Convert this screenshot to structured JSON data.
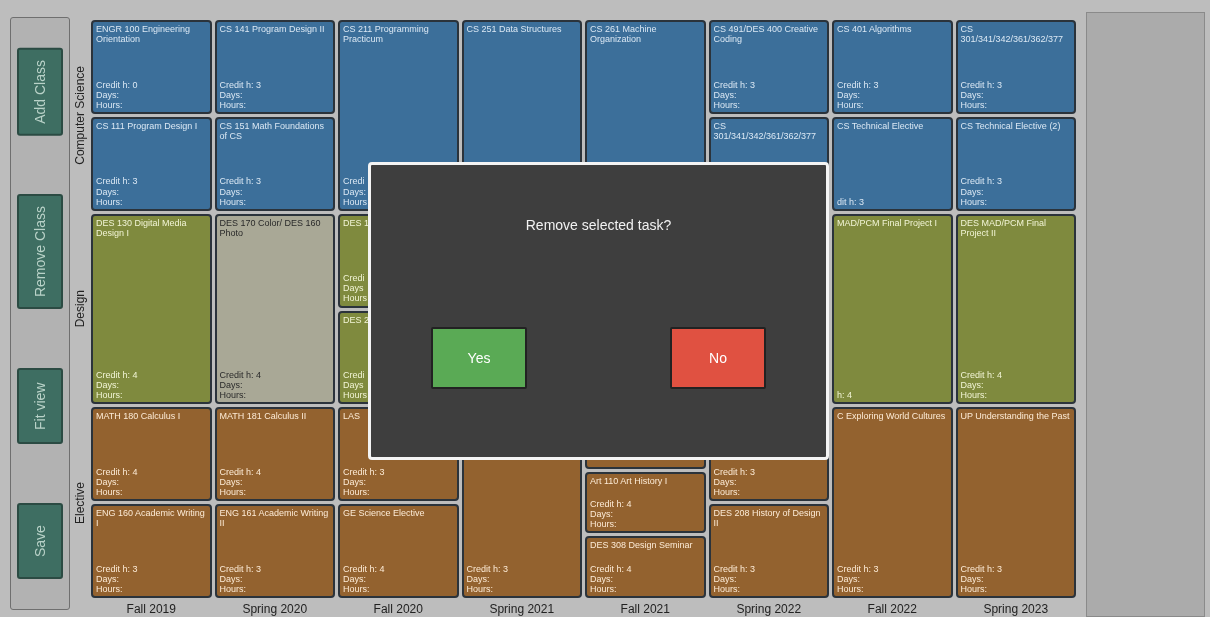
{
  "sidebar": {
    "buttons": [
      "Add Class",
      "Remove Class",
      "Fit view",
      "Save"
    ]
  },
  "rows": [
    {
      "label": "Computer Science",
      "kind": "cs"
    },
    {
      "label": "Design",
      "kind": "design"
    },
    {
      "label": "Elective",
      "kind": "elective"
    }
  ],
  "columns": [
    {
      "term": "Fall 2019",
      "sections": [
        {
          "kind": "cs",
          "cards": [
            {
              "title": "ENGR 100 Engineering Orientation",
              "credit": "Credit h: 0",
              "days": "Days:",
              "hours": "Hours:",
              "selected": false
            },
            {
              "title": "CS 111 Program Design I",
              "credit": "Credit h: 3",
              "days": "Days:",
              "hours": "Hours:",
              "selected": false
            }
          ]
        },
        {
          "kind": "design",
          "cards": [
            {
              "title": "DES 130 Digital Media Design I",
              "credit": "Credit h: 4",
              "days": "Days:",
              "hours": "Hours:",
              "selected": false
            }
          ]
        },
        {
          "kind": "elective",
          "cards": [
            {
              "title": "MATH 180 Calculus I",
              "credit": "Credit h: 4",
              "days": "Days:",
              "hours": "Hours:",
              "selected": false
            },
            {
              "title": "ENG 160 Academic Writing I",
              "credit": "Credit h: 3",
              "days": "Days:",
              "hours": "Hours:",
              "selected": false
            }
          ]
        }
      ]
    },
    {
      "term": "Spring 2020",
      "sections": [
        {
          "kind": "cs",
          "cards": [
            {
              "title": "CS 141 Program Design II",
              "credit": "Credit h: 3",
              "days": "Days:",
              "hours": "Hours:",
              "selected": false
            },
            {
              "title": "CS 151 Math Foundations of CS",
              "credit": "Credit h: 3",
              "days": "Days:",
              "hours": "Hours:",
              "selected": false
            }
          ]
        },
        {
          "kind": "design",
          "cards": [
            {
              "title": "DES 170 Color/ DES 160 Photo",
              "credit": "Credit h: 4",
              "days": "Days:",
              "hours": "Hours:",
              "selected": true
            }
          ]
        },
        {
          "kind": "elective",
          "cards": [
            {
              "title": "MATH 181 Calculus II",
              "credit": "Credit h: 4",
              "days": "Days:",
              "hours": "Hours:",
              "selected": false
            },
            {
              "title": "ENG 161 Academic Writing II",
              "credit": "Credit h: 3",
              "days": "Days:",
              "hours": "Hours:",
              "selected": false
            }
          ]
        }
      ]
    },
    {
      "term": "Fall 2020",
      "sections": [
        {
          "kind": "cs",
          "cards": [
            {
              "title": "CS 211 Programming Practicum",
              "credit": "Credi",
              "days": "Days:",
              "hours": "Hours",
              "selected": false
            }
          ]
        },
        {
          "kind": "design",
          "cards": [
            {
              "title": "DES 1",
              "credit": "Credi",
              "days": "Days",
              "hours": "Hours",
              "selected": false
            },
            {
              "title": "DES 2",
              "credit": "Credi",
              "days": "Days",
              "hours": "Hours",
              "selected": false
            }
          ]
        },
        {
          "kind": "elective",
          "cards": [
            {
              "title": "LAS",
              "credit": "Credit h: 3",
              "days": "Days:",
              "hours": "Hours:",
              "selected": false
            },
            {
              "title": "GE Science Elective",
              "credit": "Credit h: 4",
              "days": "Days:",
              "hours": "Hours:",
              "selected": false
            }
          ]
        }
      ]
    },
    {
      "term": "Spring 2021",
      "sections": [
        {
          "kind": "cs",
          "cards": [
            {
              "title": "CS 251 Data Structures",
              "selected": false
            }
          ]
        },
        {
          "kind": "elective",
          "cards": [
            {
              "credit": "Credit h: 3",
              "days": "Days:",
              "hours": "Hours:",
              "selected": false
            }
          ]
        }
      ]
    },
    {
      "term": "Fall 2021",
      "sections": [
        {
          "kind": "cs",
          "cards": [
            {
              "title": "CS 261 Machine Organization",
              "selected": false
            }
          ]
        },
        {
          "kind": "elective",
          "cards": [
            {
              "selected": false
            },
            {
              "title": "Art 110 Art History I",
              "credit": "Credit h: 4",
              "days": "Days:",
              "hours": "Hours:",
              "selected": false
            },
            {
              "title": "DES 308 Design Seminar",
              "credit": "Credit h: 4",
              "days": "Days:",
              "hours": "Hours:",
              "selected": false
            }
          ]
        }
      ]
    },
    {
      "term": "Spring 2022",
      "sections": [
        {
          "kind": "cs",
          "cards": [
            {
              "title": "CS 491/DES 400 Creative Coding",
              "credit": "Credit h: 3",
              "days": "Days:",
              "hours": "Hours:",
              "selected": false
            },
            {
              "title": "CS 301/341/342/361/362/377",
              "selected": false
            }
          ]
        },
        {
          "kind": "elective",
          "cards": [
            {
              "credit": "Credit h: 3",
              "days": "Days:",
              "hours": "Hours:",
              "selected": false
            },
            {
              "title": "DES 208 History of Design II",
              "credit": "Credit h: 3",
              "days": "Days:",
              "hours": "Hours:",
              "selected": false
            }
          ]
        }
      ]
    },
    {
      "term": "Fall 2022",
      "sections": [
        {
          "kind": "cs",
          "cards": [
            {
              "title": "CS 401 Algorithms",
              "credit": "Credit h: 3",
              "days": "Days:",
              "hours": "Hours:",
              "selected": false
            },
            {
              "title": "CS Technical Elective",
              "credit": "dit h: 3",
              "selected": false
            }
          ]
        },
        {
          "kind": "design",
          "cards": [
            {
              "title": "MAD/PCM Final Project I",
              "credit": "h: 4",
              "selected": false
            }
          ]
        },
        {
          "kind": "elective",
          "cards": [
            {
              "title": "C Exploring World Cultures",
              "credit": "Credit h: 3",
              "days": "Days:",
              "hours": "Hours:",
              "selected": false
            }
          ]
        }
      ]
    },
    {
      "term": "Spring 2023",
      "sections": [
        {
          "kind": "cs",
          "cards": [
            {
              "title": "CS 301/341/342/361/362/377",
              "credit": "Credit h: 3",
              "days": "Days:",
              "hours": "Hours:",
              "selected": false
            },
            {
              "title": "CS Technical Elective (2)",
              "credit": "Credit h: 3",
              "days": "Days:",
              "hours": "Hours:",
              "selected": false
            }
          ]
        },
        {
          "kind": "design",
          "cards": [
            {
              "title": "DES MAD/PCM Final Project II",
              "credit": "Credit h: 4",
              "days": "Days:",
              "hours": "Hours:",
              "selected": false
            }
          ]
        },
        {
          "kind": "elective",
          "cards": [
            {
              "title": "UP Understanding the Past",
              "credit": "Credit h: 3",
              "days": "Days:",
              "hours": "Hours:",
              "selected": false
            }
          ]
        }
      ]
    }
  ],
  "dialog": {
    "message": "Remove selected task?",
    "buttons": [
      {
        "label": "Yes",
        "kind": "confirm"
      },
      {
        "label": "No",
        "kind": "cancel"
      }
    ]
  }
}
